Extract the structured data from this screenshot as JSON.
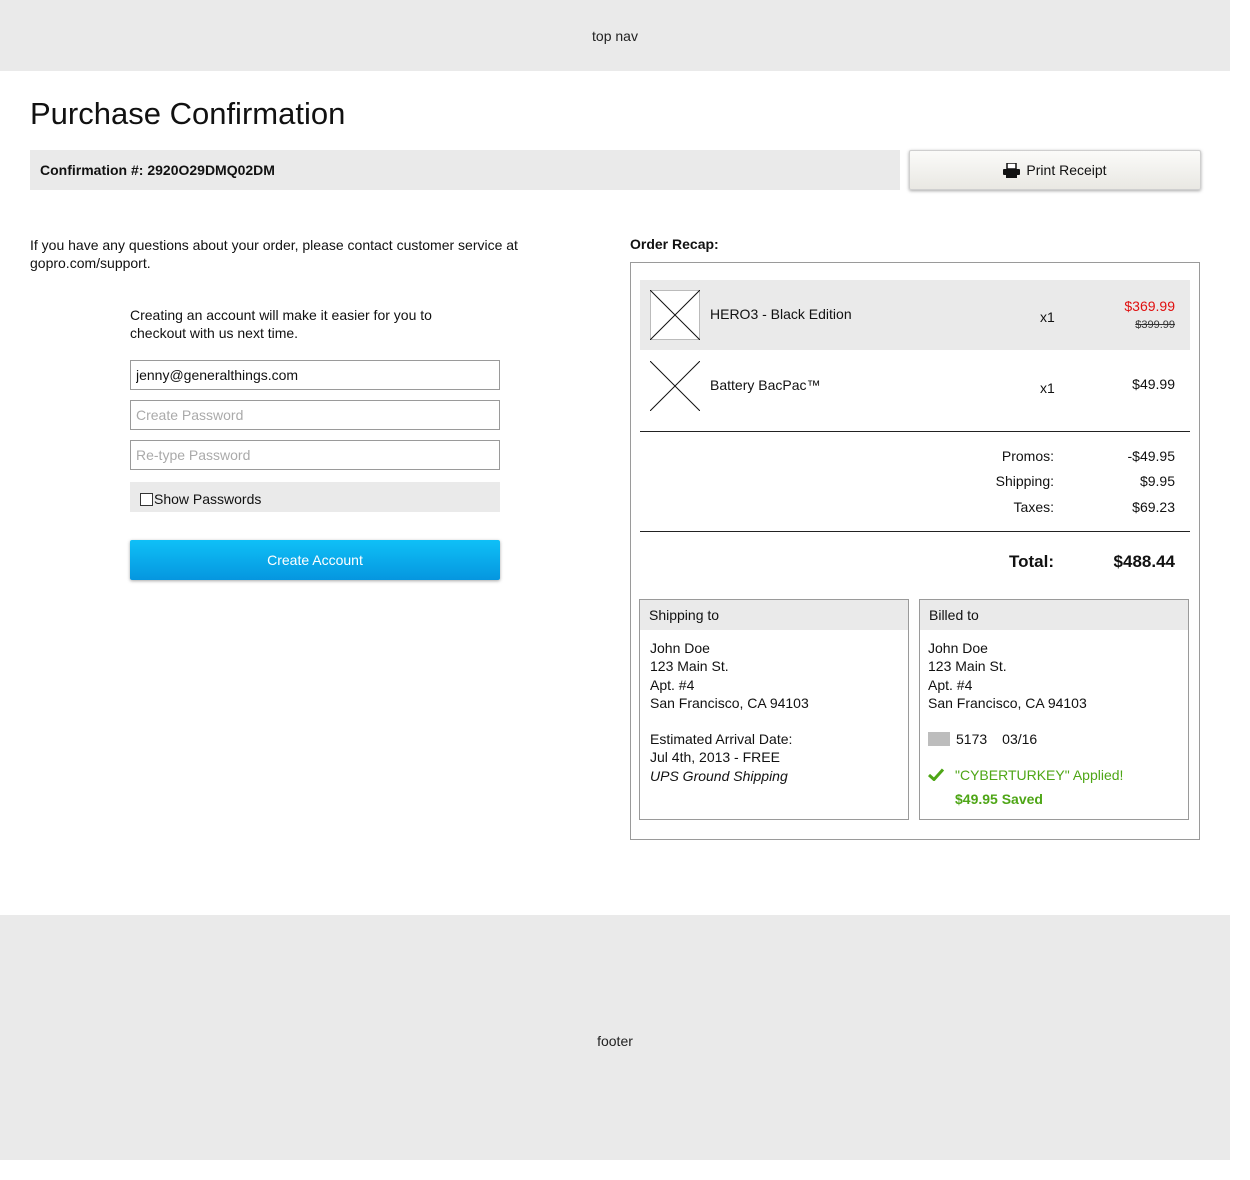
{
  "top_nav": {
    "label": "top nav"
  },
  "page": {
    "title": "Purchase Confirmation"
  },
  "confirmation": {
    "label": "Confirmation #: 2920O29DMQ02DM"
  },
  "print_receipt": {
    "label": "Print Receipt",
    "icon": "printer-icon"
  },
  "help_text": "If you have any questions about your order, please contact customer service at gopro.com/support.",
  "account": {
    "note": "Creating an account will make it easier for you to checkout with us next time.",
    "email_value": "jenny@generalthings.com",
    "password_placeholder": "Create Password",
    "retype_placeholder": "Re-type Password",
    "show_passwords_label": "Show Passwords",
    "create_button_label": "Create Account"
  },
  "order_recap": {
    "label": "Order Recap:",
    "items": [
      {
        "name": "HERO3 - Black Edition",
        "qty": "x1",
        "price": "$369.99",
        "original_price": "$399.99"
      },
      {
        "name": "Battery BacPac™",
        "qty": "x1",
        "price": "$49.99"
      }
    ],
    "summary": [
      {
        "label": "Promos:",
        "value": "-$49.95"
      },
      {
        "label": "Shipping:",
        "value": "$9.95"
      },
      {
        "label": "Taxes:",
        "value": "$69.23"
      }
    ],
    "total_label": "Total:",
    "total_value": "$488.44"
  },
  "shipping": {
    "heading": "Shipping to",
    "name": "John Doe",
    "street": "123 Main St.",
    "apt": "Apt. #4",
    "city": "San Francisco, CA 94103",
    "arrival_label": "Estimated Arrival Date:",
    "arrival_date": "Jul 4th, 2013 - FREE",
    "method": "UPS Ground Shipping"
  },
  "billing": {
    "heading": "Billed to",
    "name": "John Doe",
    "street": "123 Main St.",
    "apt": "Apt. #4",
    "city": "San Francisco, CA 94103",
    "card_last4": "5173",
    "card_exp": "03/16",
    "promo_applied": "\"CYBERTURKEY\" Applied!",
    "promo_saved": "$49.95 Saved"
  },
  "footer": {
    "label": "footer"
  },
  "colors": {
    "accent_blue": "#06a9ea",
    "sale_red": "#e01010",
    "promo_green": "#4ea616",
    "panel_gray": "#eaeaea"
  }
}
